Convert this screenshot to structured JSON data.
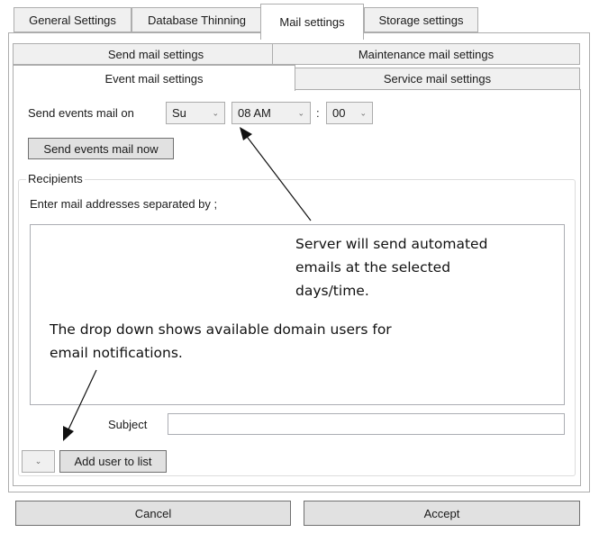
{
  "tabs_top": [
    {
      "label": "General Settings"
    },
    {
      "label": "Database Thinning"
    },
    {
      "label": "Mail settings"
    },
    {
      "label": "Storage settings"
    }
  ],
  "tabs_mail_row1": [
    {
      "label": "Send mail settings"
    },
    {
      "label": "Maintenance mail settings"
    }
  ],
  "tabs_mail_row2": [
    {
      "label": "Event mail settings"
    },
    {
      "label": "Service mail settings"
    }
  ],
  "schedule": {
    "label": "Send events mail on",
    "day": "Su",
    "hour": "08 AM",
    "separator": ":",
    "minute": "00"
  },
  "send_now_button": "Send events mail now",
  "recipients": {
    "group_label": "Recipients",
    "instruction": "Enter mail addresses separated by ;"
  },
  "subject_label": "Subject",
  "add_user_button": "Add user to list",
  "footer": {
    "cancel": "Cancel",
    "accept": "Accept"
  },
  "annotations": {
    "server_line1": "Server will send automated",
    "server_line2": "emails at the selected",
    "server_line3": "days/time.",
    "dropdown_line1": "The drop down shows available domain users for",
    "dropdown_line2": "email notifications."
  }
}
